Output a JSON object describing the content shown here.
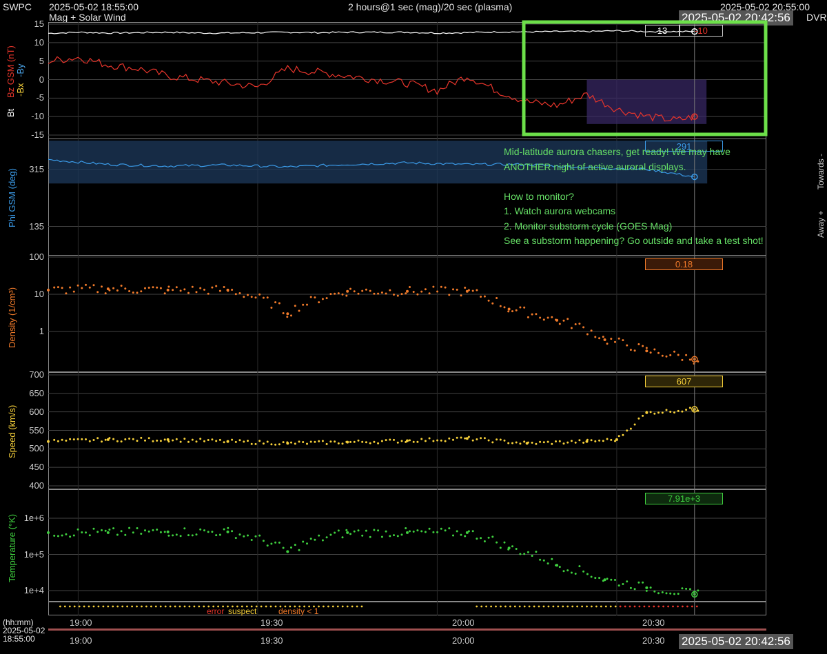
{
  "header": {
    "org": "SWPC",
    "subtitle": "Mag + Solar Wind",
    "start_time": "2025-05-02 18:55:00",
    "span": "2 hours@1 sec (mag)/20 sec (plasma)",
    "end_time": "2025-05-02 20:55:00",
    "current_stamp": "2025-05-02 20:42:56",
    "source": "DVR"
  },
  "panels": {
    "mag": {
      "ylabel_bt": "Bt",
      "ylabel_bz": "Bz GSM (nT)",
      "ylabel_by": "-By",
      "ylabel_bplus": "+By",
      "ylabel_bstar": "-Bx",
      "ticks": [
        "15",
        "10",
        "5",
        "0",
        "-5",
        "-10",
        "-15"
      ],
      "readout_bt": "13",
      "readout_bz": "-10"
    },
    "phi": {
      "ylabel": "Phi GSM (deg)",
      "ticks": [
        "315",
        "135"
      ],
      "readout": "291",
      "towards": "Towards -",
      "away": "Away +"
    },
    "density": {
      "ylabel": "Density (1/cm³)",
      "ticks": [
        "100",
        "10",
        "1"
      ],
      "readout": "0.18"
    },
    "speed": {
      "ylabel": "Speed (km/s)",
      "ticks": [
        "700",
        "650",
        "600",
        "550",
        "500",
        "450",
        "400"
      ],
      "readout": "607"
    },
    "temp": {
      "ylabel": "Temperature (°K)",
      "ticks": [
        "1e+6",
        "1e+5",
        "1e+4"
      ],
      "readout": "7.91e+3"
    }
  },
  "annotation": {
    "line1": "Mid-latitude aurora chasers, get ready! We may have",
    "line2": "ANOTHER night of active auroral displays.",
    "line3": "How to monitor?",
    "line4": "1. Watch aurora webcams",
    "line5": "2. Monitor substorm cycle (GOES Mag)",
    "line6": "See a substorm happening? Go outside and take a test shot!"
  },
  "legend": {
    "error": "error",
    "suspect": "suspect",
    "density": "density < 1"
  },
  "xaxis": {
    "unit": "(hh:mm)",
    "date": "2025-05-02",
    "time": "18:55:00",
    "ticks": [
      "19:00",
      "19:30",
      "20:00",
      "20:30"
    ]
  },
  "colors": {
    "bz": "#e8352b",
    "by": "#4aa3e8",
    "bt": "#ffffff",
    "phi": "#3b9be8",
    "density": "#f07a2a",
    "speed": "#f5cf3a",
    "temp": "#3fcf3f",
    "highlight": "#6de04a",
    "annot": "#66e066"
  },
  "chart_data": [
    {
      "type": "line",
      "title": "Mag",
      "xlabel": "(hh:mm)",
      "ylabel": "Bz GSM (nT)",
      "ylim": [
        -15,
        15
      ],
      "x": [
        "18:55",
        "19:00",
        "19:05",
        "19:10",
        "19:15",
        "19:20",
        "19:25",
        "19:30",
        "19:35",
        "19:40",
        "19:45",
        "19:50",
        "19:55",
        "20:00",
        "20:05",
        "20:10",
        "20:15",
        "20:20",
        "20:25",
        "20:30",
        "20:35",
        "20:40",
        "20:43"
      ],
      "series": [
        {
          "name": "Bt",
          "values": [
            12.5,
            12.8,
            12.6,
            12.7,
            12.8,
            12.6,
            12.6,
            12.7,
            12.8,
            12.7,
            12.8,
            12.8,
            12.8,
            12.6,
            12.7,
            12.9,
            12.9,
            13.0,
            13.0,
            13.2,
            13.0,
            13.0,
            13.0
          ]
        },
        {
          "name": "Bz",
          "values": [
            5,
            6,
            4,
            3,
            1,
            0,
            -1,
            -2,
            3,
            2,
            1,
            0,
            -1,
            -3,
            1,
            -3,
            -6,
            -7,
            -4,
            -8,
            -10,
            -11,
            -10
          ]
        }
      ]
    },
    {
      "type": "line",
      "ylabel": "Phi GSM (deg)",
      "ylim": [
        45,
        405
      ],
      "x": [
        "18:55",
        "19:05",
        "19:15",
        "19:25",
        "19:35",
        "19:45",
        "19:55",
        "20:05",
        "20:15",
        "20:25",
        "20:35",
        "20:43"
      ],
      "values": [
        345,
        330,
        325,
        328,
        322,
        330,
        335,
        330,
        330,
        320,
        315,
        291
      ]
    },
    {
      "type": "scatter",
      "ylabel": "Density (1/cm³)",
      "ylim": [
        0.1,
        100
      ],
      "x": [
        "18:55",
        "19:05",
        "19:15",
        "19:25",
        "19:35",
        "19:45",
        "19:55",
        "20:05",
        "20:12",
        "20:20",
        "20:28",
        "20:35",
        "20:43"
      ],
      "values": [
        13,
        14,
        13,
        13,
        3,
        12,
        12,
        12,
        4,
        2,
        0.6,
        0.3,
        0.18
      ]
    },
    {
      "type": "scatter",
      "ylabel": "Speed (km/s)",
      "ylim": [
        400,
        700
      ],
      "x": [
        "18:55",
        "19:05",
        "19:15",
        "19:25",
        "19:35",
        "19:45",
        "19:55",
        "20:05",
        "20:15",
        "20:25",
        "20:30",
        "20:35",
        "20:43"
      ],
      "values": [
        520,
        525,
        525,
        520,
        515,
        518,
        522,
        528,
        515,
        520,
        525,
        598,
        607
      ]
    },
    {
      "type": "scatter",
      "ylabel": "Temperature (°K)",
      "ylim": [
        5000,
        2000000
      ],
      "x": [
        "18:55",
        "19:05",
        "19:15",
        "19:25",
        "19:35",
        "19:45",
        "19:55",
        "20:05",
        "20:12",
        "20:20",
        "20:28",
        "20:35",
        "20:43"
      ],
      "values": [
        400000,
        400000,
        420000,
        420000,
        120000,
        400000,
        400000,
        400000,
        150000,
        50000,
        20000,
        12000,
        7910
      ]
    }
  ]
}
